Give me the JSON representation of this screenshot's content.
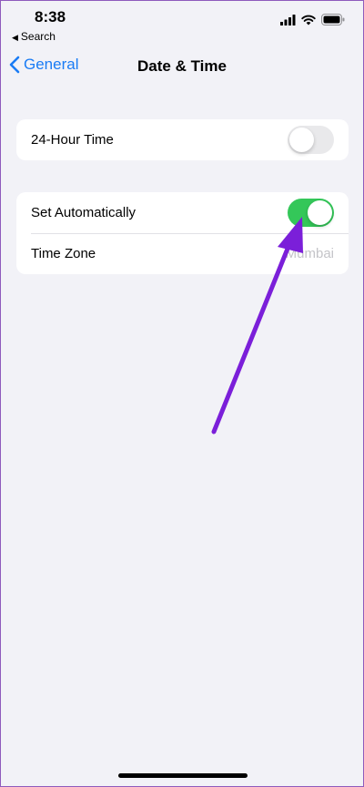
{
  "status_bar": {
    "time": "8:38",
    "back_app": "Search",
    "icons": [
      "signal-icon",
      "wifi-icon",
      "battery-icon"
    ]
  },
  "nav": {
    "back_label": "General",
    "title": "Date & Time"
  },
  "settings": {
    "hour24": {
      "label": "24-Hour Time",
      "enabled": false
    },
    "set_automatically": {
      "label": "Set Automatically",
      "enabled": true
    },
    "time_zone": {
      "label": "Time Zone",
      "value": "Mumbai"
    }
  },
  "colors": {
    "accent": "#1a7cf5",
    "toggle_on": "#34c759",
    "toggle_off": "#e9e9eb",
    "annotation": "#7b1fd9",
    "background": "#f2f2f7"
  }
}
